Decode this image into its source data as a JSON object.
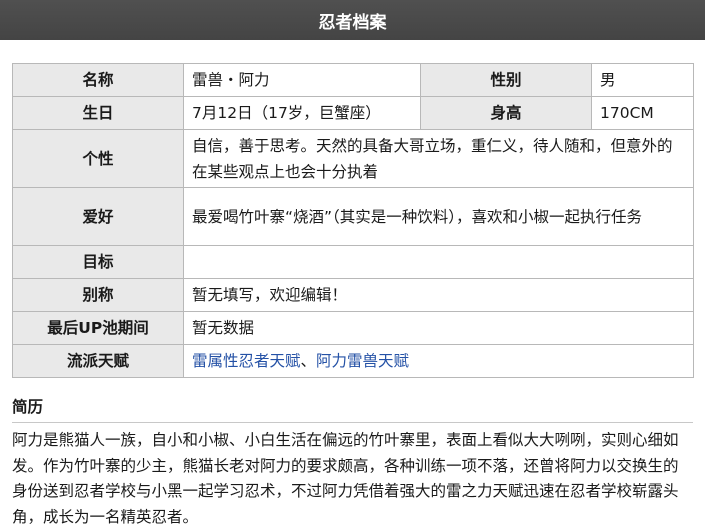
{
  "header": {
    "title": "忍者档案"
  },
  "profile": {
    "name_label": "名称",
    "name_value": "雷兽・阿力",
    "gender_label": "性别",
    "gender_value": "男",
    "birthday_label": "生日",
    "birthday_value": "7月12日（17岁，巨蟹座）",
    "height_label": "身高",
    "height_value": "170CM",
    "personality_label": "个性",
    "personality_value": "自信，善于思考。天然的具备大哥立场，重仁义，待人随和，但意外的在某些观点上也会十分执着",
    "hobby_label": "爱好",
    "hobby_value": "最爱喝竹叶寨“烧酒”（其实是一种饮料），喜欢和小椒一起执行任务",
    "goal_label": "目标",
    "goal_value": "",
    "alias_label": "别称",
    "alias_value": "暂无填写，欢迎编辑！",
    "upperiod_label": "最后UP池期间",
    "upperiod_value": "暂无数据",
    "talent_label": "流派天赋",
    "talent_links": [
      "雷属性忍者天赋",
      "阿力雷兽天赋"
    ],
    "talent_separator": "、"
  },
  "bio": {
    "title": "简历",
    "text": "阿力是熊猫人一族，自小和小椒、小白生活在偏远的竹叶寨里，表面上看似大大咧咧，实则心细如发。作为竹叶寨的少主，熊猫长老对阿力的要求颇高，各种训练一项不落，还曾将阿力以交换生的身份送到忍者学校与小黑一起学习忍术，不过阿力凭借着强大的雷之力天赋迅速在忍者学校崭露头角，成长为一名精英忍者。"
  }
}
